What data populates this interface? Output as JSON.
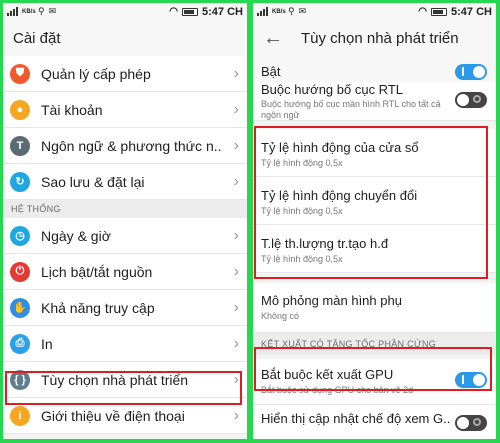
{
  "status": {
    "time": "5:47 CH",
    "speed": "KB/s"
  },
  "left": {
    "title": "Cài đặt",
    "items_top": [
      {
        "label": "Quản lý cấp phép",
        "icon": "shield-icon",
        "color": "#f05a2b",
        "glyph": "⛊"
      },
      {
        "label": "Tài khoản",
        "icon": "person-icon",
        "color": "#f5a623",
        "glyph": "●"
      },
      {
        "label": "Ngôn ngữ & phương thức n..",
        "icon": "language-icon",
        "color": "#5b6b74",
        "glyph": "T"
      },
      {
        "label": "Sao lưu & đặt lại",
        "icon": "backup-icon",
        "color": "#1ea7e0",
        "glyph": "↻"
      }
    ],
    "section": "HỆ THỐNG",
    "items_system": [
      {
        "label": "Ngày & giờ",
        "icon": "clock-icon",
        "color": "#1ea7e0",
        "glyph": "◷"
      },
      {
        "label": "Lịch bật/tắt nguồn",
        "icon": "power-icon",
        "color": "#e53935",
        "glyph": "⏻"
      },
      {
        "label": "Khả năng truy cập",
        "icon": "hand-icon",
        "color": "#2f8fe8",
        "glyph": "✋"
      },
      {
        "label": "In",
        "icon": "printer-icon",
        "color": "#2aa0e8",
        "glyph": "⎙"
      },
      {
        "label": "Tùy chọn nhà phát triển",
        "icon": "code-icon",
        "color": "#607d8b",
        "glyph": "{ }"
      },
      {
        "label": "Giới thiệu về điện thoại",
        "icon": "info-icon",
        "color": "#f5a623",
        "glyph": "i"
      }
    ]
  },
  "right": {
    "title": "Tùy chọn nhà phát triển",
    "on_label": "Bật",
    "rtl": {
      "title": "Buộc hướng bố cục RTL",
      "sub": "Buộc hướng bố cục màn hình RTL cho tất cả ngôn ngữ"
    },
    "anim": [
      {
        "title": "Tỷ lệ hình động của cửa sổ",
        "sub": "Tỷ lệ hình động 0,5x"
      },
      {
        "title": "Tỷ lệ hình động chuyển đổi",
        "sub": "Tỷ lệ hình động 0,5x"
      },
      {
        "title": "T.lệ th.lượng tr.tạo h.đ",
        "sub": "Tỷ lệ hình động 0,5x"
      }
    ],
    "display": {
      "title": "Mô phỏng màn hình phụ",
      "sub": "Không có"
    },
    "section": "KẾT XUẤT CÓ TĂNG TỐC PHẦN CỨNG",
    "gpu": {
      "title": "Bắt buộc kết xuất GPU",
      "sub": "Bắt buộc sử dụng GPU cho bản vẽ 2d"
    },
    "last": {
      "title": "Hiển thị cập nhật chế độ xem G.."
    }
  }
}
